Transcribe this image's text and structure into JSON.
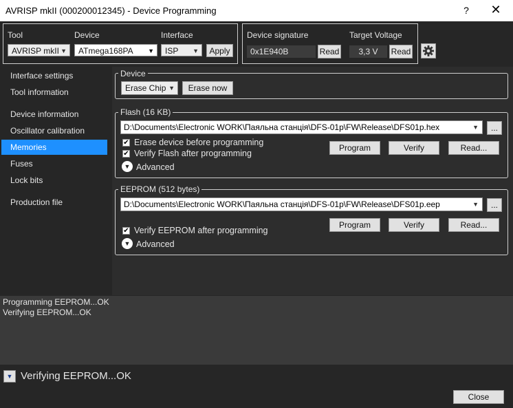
{
  "window": {
    "title": "AVRISP mkII (000200012345) - Device Programming",
    "help_label": "?",
    "close_label": "✕"
  },
  "toolbar": {
    "tool_label": "Tool",
    "tool_value": "AVRISP mkII",
    "device_label": "Device",
    "device_value": "ATmega168PA",
    "interface_label": "Interface",
    "interface_value": "ISP",
    "apply_label": "Apply",
    "signature_label": "Device signature",
    "signature_value": "0x1E940B",
    "signature_read_label": "Read",
    "voltage_label": "Target Voltage",
    "voltage_value": "3,3 V",
    "voltage_read_label": "Read",
    "settings_icon": "gear-icon"
  },
  "sidebar": {
    "items": [
      {
        "label": "Interface settings",
        "selected": false
      },
      {
        "label": "Tool information",
        "selected": false
      },
      {
        "label": "Device information",
        "selected": false
      },
      {
        "label": "Oscillator calibration",
        "selected": false
      },
      {
        "label": "Memories",
        "selected": true
      },
      {
        "label": "Fuses",
        "selected": false
      },
      {
        "label": "Lock bits",
        "selected": false
      },
      {
        "label": "Production file",
        "selected": false
      }
    ]
  },
  "device_group": {
    "title": "Device",
    "erase_select": "Erase Chip",
    "erase_now_label": "Erase now"
  },
  "flash_group": {
    "title": "Flash (16 KB)",
    "path": "D:\\Documents\\Electronic WORK\\Паяльна станція\\DFS-01p\\FW\\Release\\DFS01p.hex",
    "browse_label": "...",
    "erase_before_label": "Erase device before programming",
    "erase_before_checked": true,
    "verify_label": "Verify Flash after programming",
    "verify_checked": true,
    "advanced_label": "Advanced",
    "program_label": "Program",
    "verify_button_label": "Verify",
    "read_label": "Read..."
  },
  "eeprom_group": {
    "title": "EEPROM (512 bytes)",
    "path": "D:\\Documents\\Electronic WORK\\Паяльна станція\\DFS-01p\\FW\\Release\\DFS01p.eep",
    "browse_label": "...",
    "verify_label": "Verify EEPROM after programming",
    "verify_checked": true,
    "advanced_label": "Advanced",
    "program_label": "Program",
    "verify_button_label": "Verify",
    "read_label": "Read..."
  },
  "log": {
    "lines": [
      "Programming EEPROM...OK",
      "Verifying EEPROM...OK"
    ]
  },
  "status": {
    "text": "Verifying EEPROM...OK",
    "close_label": "Close"
  },
  "colors": {
    "background": "#262626",
    "selected": "#1e90ff",
    "panel": "#2d2d2d",
    "log_bg": "#3a3a3a"
  }
}
